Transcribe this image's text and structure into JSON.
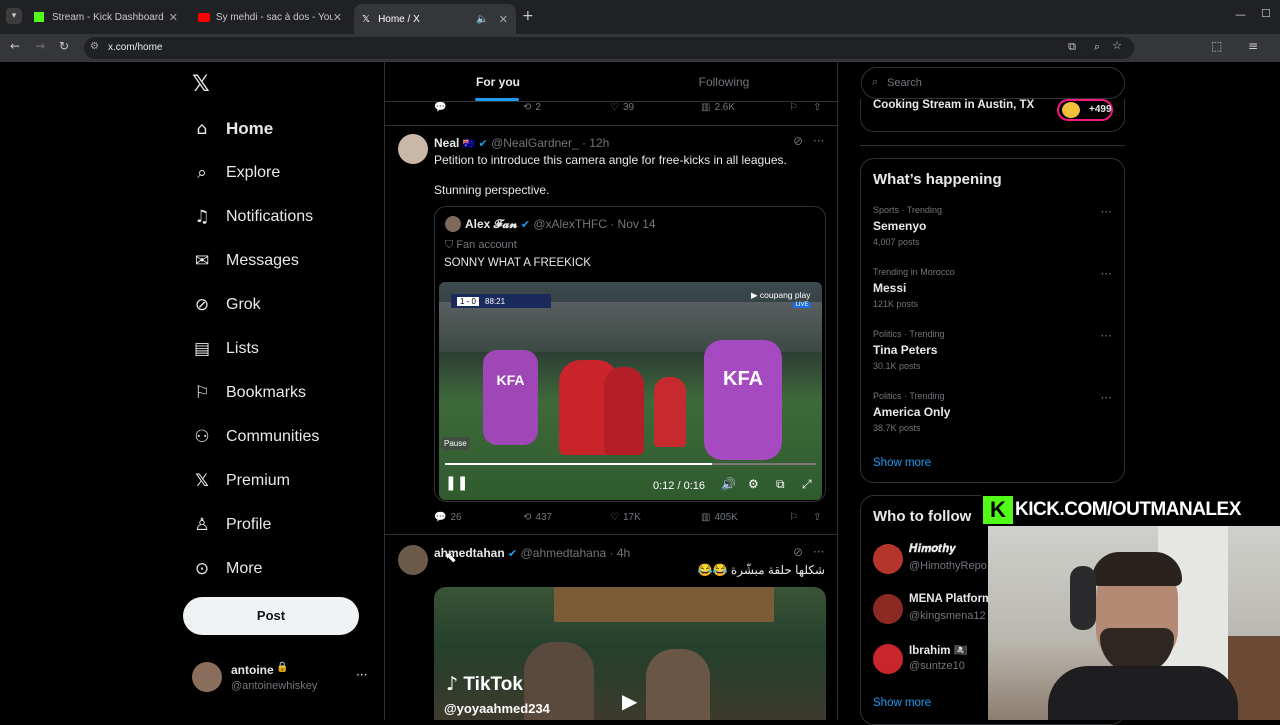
{
  "browser": {
    "tabs": [
      {
        "title": "Stream - Kick Dashboard"
      },
      {
        "title": "Sy mehdi - sac à dos - YouTube"
      },
      {
        "title": "Home / X"
      }
    ],
    "url": "x.com/home"
  },
  "sidebar": {
    "items": [
      {
        "label": "Home",
        "icon": "home-icon"
      },
      {
        "label": "Explore",
        "icon": "search-icon"
      },
      {
        "label": "Notifications",
        "icon": "bell-icon"
      },
      {
        "label": "Messages",
        "icon": "mail-icon"
      },
      {
        "label": "Grok",
        "icon": "grok-icon"
      },
      {
        "label": "Lists",
        "icon": "list-icon"
      },
      {
        "label": "Bookmarks",
        "icon": "bookmark-icon"
      },
      {
        "label": "Communities",
        "icon": "people-icon"
      },
      {
        "label": "Premium",
        "icon": "x-icon"
      },
      {
        "label": "Profile",
        "icon": "person-icon"
      },
      {
        "label": "More",
        "icon": "more-icon"
      }
    ],
    "post_label": "Post",
    "account": {
      "name": "antoine",
      "handle": "@antoinewhiskey"
    }
  },
  "feed": {
    "tabs": [
      "For you",
      "Following"
    ],
    "prev_actions": {
      "retweets": "2",
      "likes": "39",
      "views": "2.6K"
    },
    "tweet1": {
      "name": "Neal",
      "handle": "@NealGardner_ · 12h",
      "text1": "Petition to introduce this camera angle for free-kicks in all leagues.",
      "text2": "Stunning perspective.",
      "quote": {
        "name": "Alex 𝓕𝓪𝓷",
        "handle": "@xAlexTHFC · Nov 14",
        "label": "Fan account",
        "text": "SONNY WHAT A FREEKICK"
      },
      "video": {
        "time": "0:12 / 0:16",
        "progress": 0.72,
        "pause_tip": "Pause",
        "score": "1 - 0",
        "clock": "88:21",
        "brand": "coupang play",
        "live": "LIVE",
        "bib1": "KFA",
        "bib2": "KFA"
      },
      "actions": {
        "replies": "26",
        "retweets": "437",
        "likes": "17K",
        "views": "405K"
      }
    },
    "tweet2": {
      "name": "ahmedtahan",
      "handle": "@ahmedtahana · 4h",
      "text": "شكلها حلقة مبشّرة 😂😂",
      "tiktok": "TikTok",
      "tiktok_handle": "@yoyaahmed234"
    }
  },
  "right": {
    "search_placeholder": "Search",
    "live_title": "Cooking Stream in Austin, TX",
    "live_count": "+499",
    "happening_title": "What’s happening",
    "trends": [
      {
        "category": "Sports · Trending",
        "name": "Semenyo",
        "count": "4,007 posts"
      },
      {
        "category": "Trending in Morocco",
        "name": "Messi",
        "count": "121K posts"
      },
      {
        "category": "Politics · Trending",
        "name": "Tina Peters",
        "count": "30.1K posts"
      },
      {
        "category": "Politics · Trending",
        "name": "America Only",
        "count": "38.7K posts"
      }
    ],
    "show_more": "Show more",
    "wtf_title": "Who to follow",
    "follow": [
      {
        "name": "𝑯𝒊𝒎𝒐𝒕𝒉𝒚",
        "handle": "@HimothyRepo"
      },
      {
        "name": "MENA Platform",
        "handle": "@kingsmena12"
      },
      {
        "name": "Ibrahim 🏴‍☠️",
        "handle": "@suntze10"
      }
    ],
    "show_more2": "Show more"
  },
  "overlay": {
    "kick_url": "KICK.COM/OUTMANALEX",
    "kick_logo": "K"
  }
}
